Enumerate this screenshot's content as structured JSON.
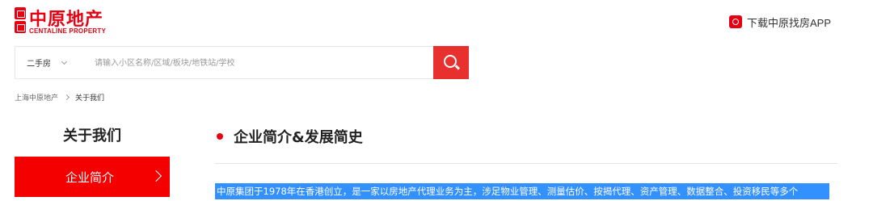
{
  "header": {
    "logo_cn": "中原地产",
    "logo_en": "CENTALINE PROPERTY",
    "app_download": "下载中原找房APP"
  },
  "search": {
    "type_selected": "二手房",
    "placeholder": "请输入小区名称/区域/板块/地铁站/学校"
  },
  "breadcrumb": {
    "home": "上海中原地产",
    "current": "关于我们"
  },
  "sidebar": {
    "title": "关于我们",
    "items": [
      {
        "label": "企业简介",
        "active": true
      }
    ]
  },
  "main": {
    "section_title": "企业简介&发展简史",
    "intro_text": "中原集团于1978年在香港创立，是一家以房地产代理业务为主，涉足物业管理、测量估价、按揭代理、资产管理、数据整合、投资移民等多个"
  },
  "colors": {
    "brand_red": "#e60012",
    "search_button": "#e8312e",
    "active_item": "#f40000",
    "selection": "#3390ff"
  }
}
